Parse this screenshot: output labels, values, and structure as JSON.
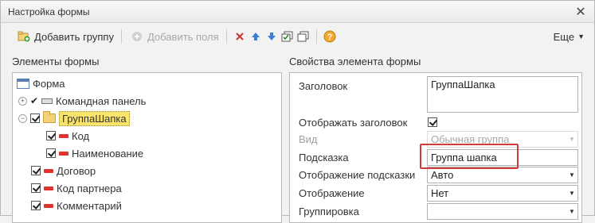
{
  "window": {
    "title": "Настройка формы"
  },
  "toolbar": {
    "add_group_label": "Добавить группу",
    "add_fields_label": "Добавить поля",
    "more_label": "Еще"
  },
  "left_panel": {
    "heading": "Элементы формы",
    "tree": [
      {
        "label": "Форма",
        "level": 0,
        "icon": "form-icon"
      },
      {
        "label": "Командная панель",
        "level": 1,
        "icon": "command-bar-icon",
        "expander": "+"
      },
      {
        "label": "ГруппаШапка",
        "level": 1,
        "icon": "folder-icon",
        "expander": "−",
        "checked": true,
        "selected": true
      },
      {
        "label": "Код",
        "level": 2,
        "icon": "field-icon",
        "checked": true
      },
      {
        "label": "Наименование",
        "level": 2,
        "icon": "field-icon",
        "checked": true
      },
      {
        "label": "Договор",
        "level": 1,
        "icon": "field-icon",
        "checked": true
      },
      {
        "label": "Код партнера",
        "level": 1,
        "icon": "field-icon",
        "checked": true
      },
      {
        "label": "Комментарий",
        "level": 1,
        "icon": "field-icon",
        "checked": true
      }
    ]
  },
  "right_panel": {
    "heading": "Свойства элемента формы",
    "props": {
      "caption_label": "Заголовок",
      "caption_value": "ГруппаШапка",
      "show_caption_label": "Отображать заголовок",
      "show_caption_checked": true,
      "kind_label": "Вид",
      "kind_value": "Обычная группа",
      "tooltip_label": "Подсказка",
      "tooltip_value": "Группа шапка",
      "tooltip_display_label": "Отображение подсказки",
      "tooltip_display_value": "Авто",
      "display_label": "Отображение",
      "display_value": "Нет",
      "grouping_label": "Группировка",
      "grouping_value": ""
    }
  },
  "colors": {
    "highlight": "#d23b3b",
    "selection": "#fbe46b"
  }
}
